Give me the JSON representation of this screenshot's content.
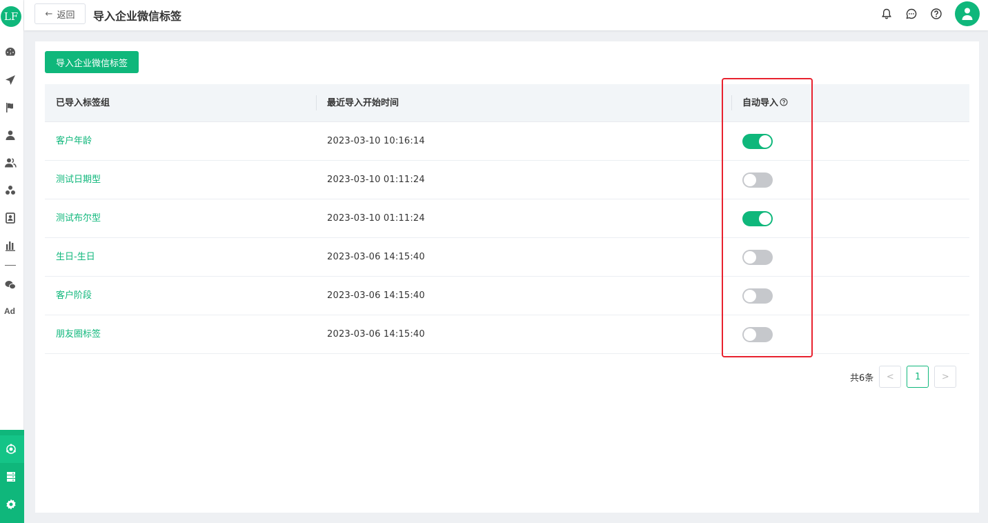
{
  "app": {
    "logo_text": "LF"
  },
  "header": {
    "back_label": "返回",
    "title": "导入企业微信标签"
  },
  "toolbar": {
    "import_label": "导入企业微信标签"
  },
  "table": {
    "columns": [
      "已导入标签组",
      "最近导入开始时间",
      "自动导入"
    ],
    "rows": [
      {
        "name": "客户年龄",
        "time": "2023-03-10 10:16:14",
        "auto": true
      },
      {
        "name": "测试日期型",
        "time": "2023-03-10 01:11:24",
        "auto": false
      },
      {
        "name": "测试布尔型",
        "time": "2023-03-10 01:11:24",
        "auto": true
      },
      {
        "name": "生日-生日",
        "time": "2023-03-06 14:15:40",
        "auto": false
      },
      {
        "name": "客户阶段",
        "time": "2023-03-06 14:15:40",
        "auto": false
      },
      {
        "name": "朋友圈标签",
        "time": "2023-03-06 14:15:40",
        "auto": false
      }
    ]
  },
  "pagination": {
    "total_text": "共6条",
    "current_page": "1",
    "prev": "<",
    "next": ">"
  },
  "sidebar": {
    "ad_label": "Ad"
  },
  "colors": {
    "brand": "#0fb77b",
    "highlight": "#e8212e"
  }
}
